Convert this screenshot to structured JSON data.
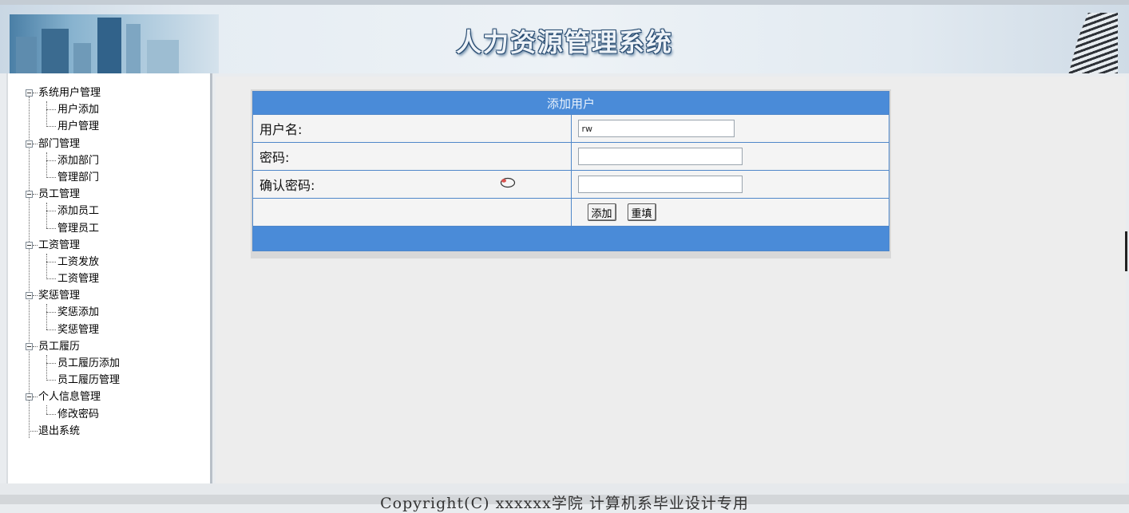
{
  "header": {
    "title": "人力资源管理系统"
  },
  "sidebar": {
    "groups": [
      {
        "label": "系统用户管理",
        "items": [
          "用户添加",
          "用户管理"
        ]
      },
      {
        "label": "部门管理",
        "items": [
          "添加部门",
          "管理部门"
        ]
      },
      {
        "label": "员工管理",
        "items": [
          "添加员工",
          "管理员工"
        ]
      },
      {
        "label": "工资管理",
        "items": [
          "工资发放",
          "工资管理"
        ]
      },
      {
        "label": "奖惩管理",
        "items": [
          "奖惩添加",
          "奖惩管理"
        ]
      },
      {
        "label": "员工履历",
        "items": [
          "员工履历添加",
          "员工履历管理"
        ]
      },
      {
        "label": "个人信息管理",
        "items": [
          "修改密码"
        ]
      }
    ],
    "logout": "退出系统"
  },
  "form": {
    "title": "添加用户",
    "username_label": "用户名:",
    "username_value": "rw",
    "password_label": "密码:",
    "password_value": "",
    "confirm_label": "确认密码:",
    "confirm_value": "",
    "add_button": "添加",
    "reset_button": "重填"
  },
  "footer": {
    "copyright": "Copyright(C) xxxxxx学院 计算机系毕业设计专用"
  }
}
